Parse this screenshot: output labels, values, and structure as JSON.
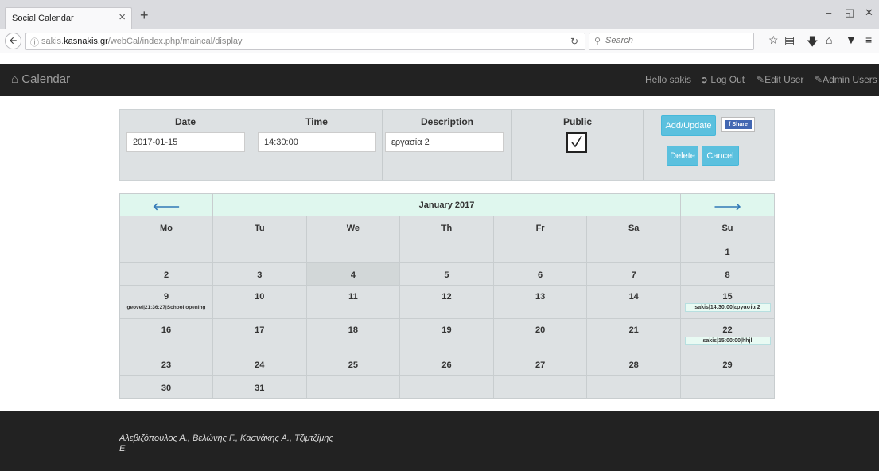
{
  "browser": {
    "tab_title": "Social Calendar",
    "tab_close": "×",
    "new_tab": "+",
    "url_prefix": "sakis.",
    "url_domain": "kasnakis.gr",
    "url_path": "/webCal/index.php/maincal/display",
    "search_placeholder": "Search"
  },
  "navbar": {
    "brand": "Calendar",
    "greeting": "Hello sakis",
    "logout": "Log Out",
    "edit_user": "Edit User",
    "admin_users": "Admin Users"
  },
  "form": {
    "date_label": "Date",
    "date_value": "2017-01-15",
    "time_label": "Time",
    "time_value": "14:30:00",
    "description_label": "Description",
    "description_value": "εργασία 2",
    "public_label": "Public",
    "public_checked": true,
    "add_update_label": "Add/Update",
    "share_label": "Share",
    "delete_label": "Delete",
    "cancel_label": "Cancel"
  },
  "calendar": {
    "month_title": "January 2017",
    "prev_arrow": "🡐",
    "next_arrow": "🡒",
    "days_of_week": [
      "Mo",
      "Tu",
      "We",
      "Th",
      "Fr",
      "Sa",
      "Su"
    ],
    "weeks": [
      [
        "",
        "",
        "",
        "",
        "",
        "",
        "1"
      ],
      [
        "2",
        "3",
        "4",
        "5",
        "6",
        "7",
        "8"
      ],
      [
        "9",
        "10",
        "11",
        "12",
        "13",
        "14",
        "15"
      ],
      [
        "16",
        "17",
        "18",
        "19",
        "20",
        "21",
        "22"
      ],
      [
        "23",
        "24",
        "25",
        "26",
        "27",
        "28",
        "29"
      ],
      [
        "30",
        "31",
        "",
        "",
        "",
        "",
        ""
      ]
    ],
    "events": {
      "day9": "geovel|21:36:27|School opening",
      "day15": "sakis|14:30:00|εργασία 2",
      "day22": "sakis|15:00:00|hhjl"
    }
  },
  "footer": {
    "credits": "Αλεβιζόπουλος Α., Βελώνης Γ., Κασνάκης Α., Τζιμτζίμης Ε."
  }
}
